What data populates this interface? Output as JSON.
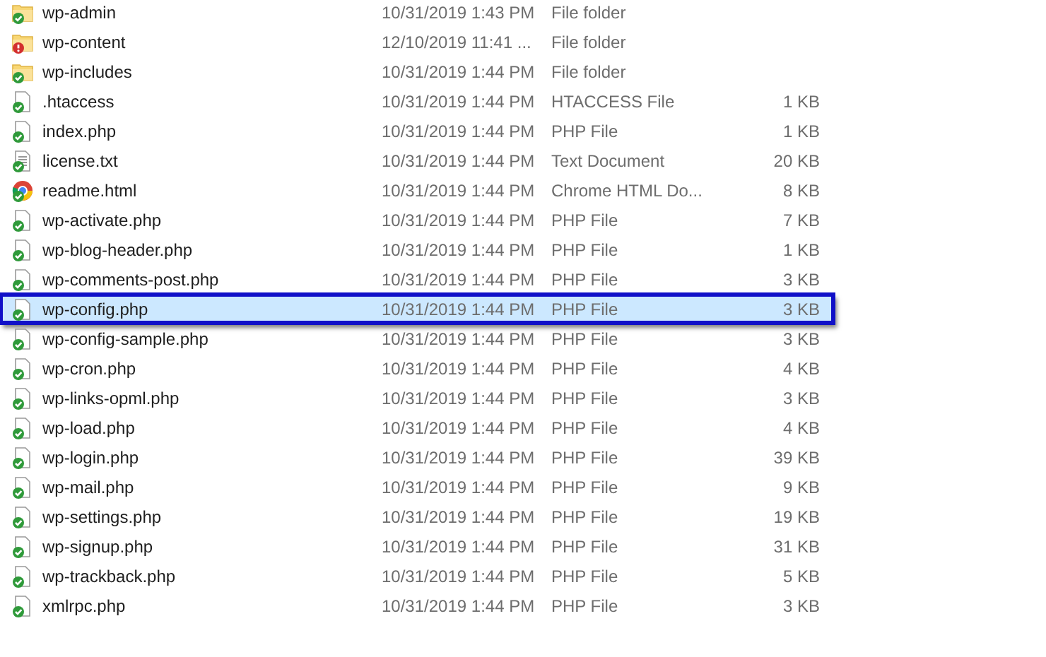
{
  "files": [
    {
      "name": "wp-admin",
      "modified": "10/31/2019 1:43 PM",
      "type": "File folder",
      "kind": "folder",
      "error": false,
      "selected": false
    },
    {
      "name": "wp-content",
      "modified": "12/10/2019 11:41 ...",
      "type": "File folder",
      "kind": "folder",
      "error": true,
      "selected": false
    },
    {
      "name": "wp-includes",
      "modified": "10/31/2019 1:44 PM",
      "type": "File folder",
      "kind": "folder",
      "error": false,
      "selected": false
    },
    {
      "name": ".htaccess",
      "modified": "10/31/2019 1:44 PM",
      "type": "HTACCESS File",
      "size": "1 KB",
      "kind": "file",
      "error": false,
      "selected": false
    },
    {
      "name": "index.php",
      "modified": "10/31/2019 1:44 PM",
      "type": "PHP File",
      "size": "1 KB",
      "kind": "file",
      "error": false,
      "selected": false
    },
    {
      "name": "license.txt",
      "modified": "10/31/2019 1:44 PM",
      "type": "Text Document",
      "size": "20 KB",
      "kind": "text",
      "error": false,
      "selected": false
    },
    {
      "name": "readme.html",
      "modified": "10/31/2019 1:44 PM",
      "type": "Chrome HTML Do...",
      "size": "8 KB",
      "kind": "browser",
      "error": false,
      "selected": false
    },
    {
      "name": "wp-activate.php",
      "modified": "10/31/2019 1:44 PM",
      "type": "PHP File",
      "size": "7 KB",
      "kind": "file",
      "error": false,
      "selected": false
    },
    {
      "name": "wp-blog-header.php",
      "modified": "10/31/2019 1:44 PM",
      "type": "PHP File",
      "size": "1 KB",
      "kind": "file",
      "error": false,
      "selected": false
    },
    {
      "name": "wp-comments-post.php",
      "modified": "10/31/2019 1:44 PM",
      "type": "PHP File",
      "size": "3 KB",
      "kind": "file",
      "error": false,
      "selected": false
    },
    {
      "name": "wp-config.php",
      "modified": "10/31/2019 1:44 PM",
      "type": "PHP File",
      "size": "3 KB",
      "kind": "file",
      "error": false,
      "selected": true
    },
    {
      "name": "wp-config-sample.php",
      "modified": "10/31/2019 1:44 PM",
      "type": "PHP File",
      "size": "3 KB",
      "kind": "file",
      "error": false,
      "selected": false
    },
    {
      "name": "wp-cron.php",
      "modified": "10/31/2019 1:44 PM",
      "type": "PHP File",
      "size": "4 KB",
      "kind": "file",
      "error": false,
      "selected": false
    },
    {
      "name": "wp-links-opml.php",
      "modified": "10/31/2019 1:44 PM",
      "type": "PHP File",
      "size": "3 KB",
      "kind": "file",
      "error": false,
      "selected": false
    },
    {
      "name": "wp-load.php",
      "modified": "10/31/2019 1:44 PM",
      "type": "PHP File",
      "size": "4 KB",
      "kind": "file",
      "error": false,
      "selected": false
    },
    {
      "name": "wp-login.php",
      "modified": "10/31/2019 1:44 PM",
      "type": "PHP File",
      "size": "39 KB",
      "kind": "file",
      "error": false,
      "selected": false
    },
    {
      "name": "wp-mail.php",
      "modified": "10/31/2019 1:44 PM",
      "type": "PHP File",
      "size": "9 KB",
      "kind": "file",
      "error": false,
      "selected": false
    },
    {
      "name": "wp-settings.php",
      "modified": "10/31/2019 1:44 PM",
      "type": "PHP File",
      "size": "19 KB",
      "kind": "file",
      "error": false,
      "selected": false
    },
    {
      "name": "wp-signup.php",
      "modified": "10/31/2019 1:44 PM",
      "type": "PHP File",
      "size": "31 KB",
      "kind": "file",
      "error": false,
      "selected": false
    },
    {
      "name": "wp-trackback.php",
      "modified": "10/31/2019 1:44 PM",
      "type": "PHP File",
      "size": "5 KB",
      "kind": "file",
      "error": false,
      "selected": false
    },
    {
      "name": "xmlrpc.php",
      "modified": "10/31/2019 1:44 PM",
      "type": "PHP File",
      "size": "3 KB",
      "kind": "file",
      "error": false,
      "selected": false
    }
  ]
}
